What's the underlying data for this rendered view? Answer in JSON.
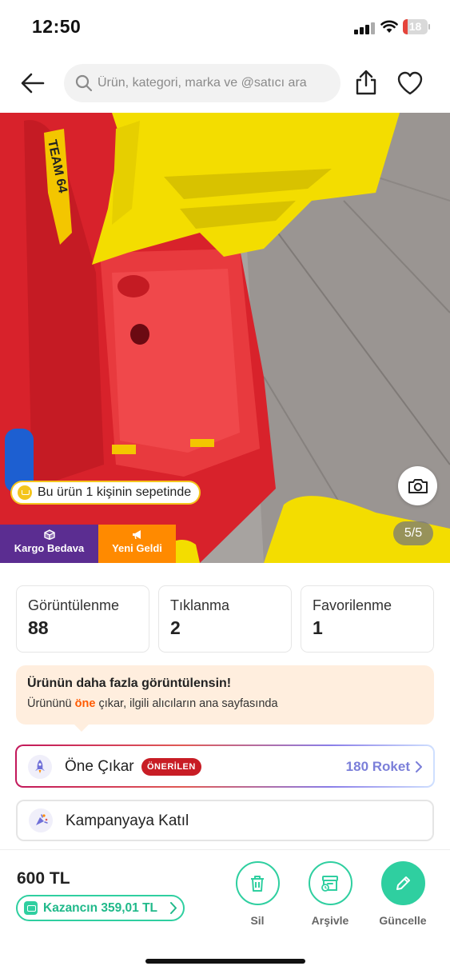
{
  "status_bar": {
    "time": "12:50",
    "battery": "18",
    "battery_level": 0.18
  },
  "header": {
    "search_placeholder": "Ürün, kategori, marka ve @satıcı ara"
  },
  "image": {
    "basket_badge": "Bu ürün 1 kişinin sepetinde",
    "page_counter": "5/5",
    "toy_decal": "TEAM 64",
    "tags": [
      {
        "label": "Kargo Bedava",
        "color": "#5b2d91",
        "icon": "box-icon"
      },
      {
        "label": "Yeni Geldi",
        "color": "#ff8a00",
        "icon": "megaphone-icon"
      }
    ]
  },
  "stats": [
    {
      "label": "Görüntülenme",
      "value": "88"
    },
    {
      "label": "Tıklanma",
      "value": "2"
    },
    {
      "label": "Favorilenme",
      "value": "1"
    }
  ],
  "promo": {
    "title": "Ürünün daha fazla görüntülensin!",
    "text_before": "Ürününü ",
    "highlight": "öne",
    "text_after": " çıkar, ilgili alıcıların ana sayfasında"
  },
  "actions": {
    "one_cikar": {
      "label": "Öne Çıkar",
      "badge": "ÖNERİLEN",
      "cost": "180 Roket"
    },
    "kampanya": {
      "label": "Kampanyaya Katıl"
    }
  },
  "bottom": {
    "price": "600 TL",
    "earn": "Kazancın 359,01 TL",
    "buttons": [
      {
        "label": "Sil",
        "icon": "trash-icon"
      },
      {
        "label": "Arşivle",
        "icon": "archive-icon"
      },
      {
        "label": "Güncelle",
        "icon": "pencil-icon"
      }
    ]
  },
  "colors": {
    "accent": "#2fcfa0",
    "promo_highlight": "#ff5a00",
    "badge_red": "#c81d25",
    "roket": "#7b7fd9"
  }
}
